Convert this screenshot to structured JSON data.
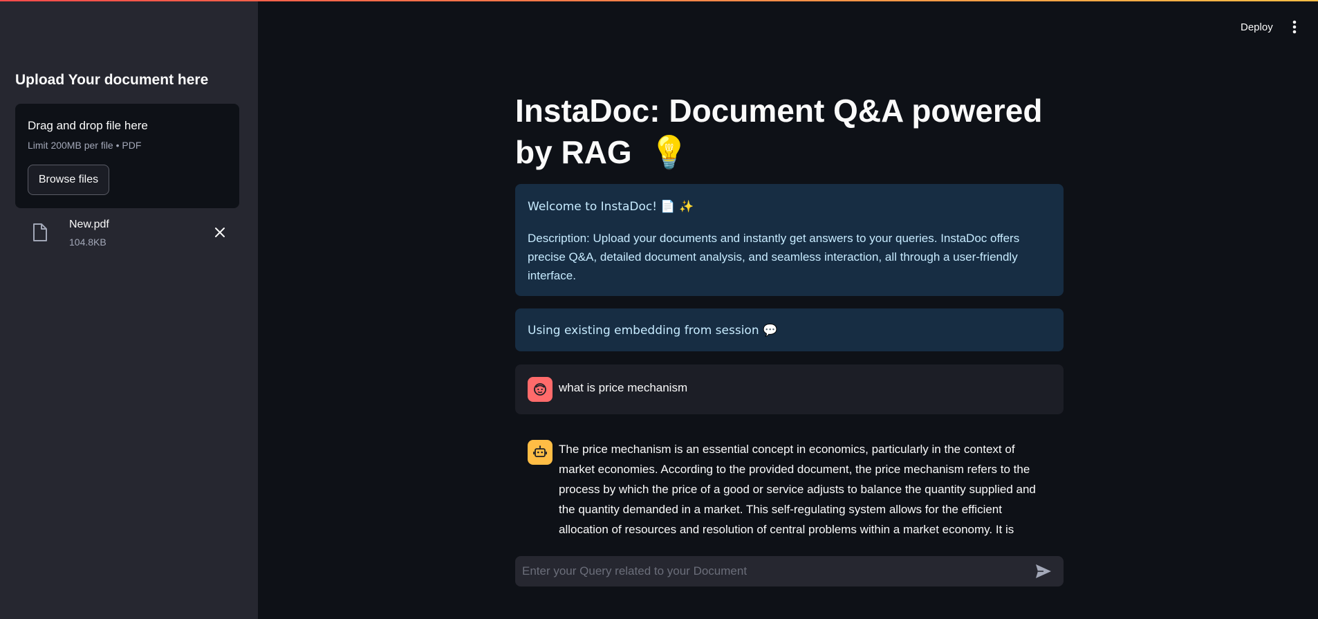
{
  "colors": {
    "background": "#0e1117",
    "sidebar": "#262730",
    "info_box": "#172d43",
    "info_text": "#c7ebff",
    "user_avatar": "#ff6b6b",
    "assistant_avatar": "#ffbd45"
  },
  "header": {
    "deploy_label": "Deploy",
    "menu_icon": "vertical-ellipsis-icon"
  },
  "sidebar": {
    "title": "Upload Your document here",
    "uploader": {
      "drop_label": "Drag and drop file here",
      "limit_text": "Limit 200MB per file • PDF",
      "browse_label": "Browse files"
    },
    "file": {
      "icon": "file-icon",
      "name": "New.pdf",
      "size": "104.8KB",
      "remove_icon": "close-icon"
    }
  },
  "main": {
    "title": "InstaDoc: Document Q&A powered by RAG",
    "title_emoji": "💡",
    "welcome": "Welcome to InstaDoc! 📄 ✨",
    "description": "Description: Upload your documents and instantly get answers to your queries. InstaDoc offers precise Q&A, detailed document analysis, and seamless interaction, all through a user-friendly interface.",
    "status": "Using existing embedding from session 💬",
    "messages": [
      {
        "role": "user",
        "avatar_icon": "user-face-icon",
        "text": "what is price mechanism"
      },
      {
        "role": "assistant",
        "avatar_icon": "robot-icon",
        "text": "The price mechanism is an essential concept in economics, particularly in the context of market economies. According to the provided document, the price mechanism refers to the process by which the price of a good or service adjusts to balance the quantity supplied and the quantity demanded in a market. This self-regulating system allows for the efficient allocation of resources and resolution of central problems within a market economy. It is through the price mechanism"
      }
    ],
    "query": {
      "placeholder": "Enter your Query related to your Document",
      "value": "",
      "send_icon": "send-icon"
    }
  }
}
